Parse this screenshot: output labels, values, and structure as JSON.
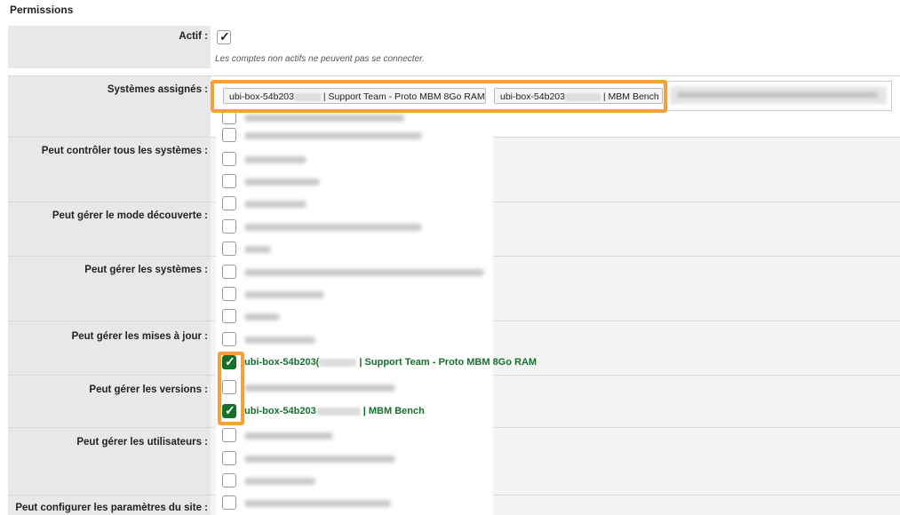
{
  "section": {
    "title": "Permissions"
  },
  "rows": {
    "actif": {
      "label": "Actif :",
      "hint": "Les comptes non actifs ne peuvent pas se connecter."
    },
    "systemes": {
      "label": "Systèmes assignés :"
    },
    "controler": {
      "label": "Peut contrôler tous les systèmes :"
    },
    "decouverte": {
      "label": "Peut gérer le mode découverte :"
    },
    "systemes_gerer": {
      "label": "Peut gérer les systèmes :"
    },
    "mises_a_jour": {
      "label": "Peut gérer les mises à jour :"
    },
    "versions": {
      "label": "Peut gérer les versions :"
    },
    "utilisateurs": {
      "label": "Peut gérer les utilisateurs :"
    },
    "parametres": {
      "label": "Peut configurer les paramètres du site :"
    }
  },
  "tags": [
    {
      "prefix": "ubi-box-54b203",
      "suffix": "| Support Team - Proto MBM 8Go RAM"
    },
    {
      "prefix": "ubi-box-54b203",
      "suffix": "| MBM Bench"
    }
  ],
  "options": {
    "checked1": {
      "prefix": "ubi-box-54b203(",
      "suffix": "| Support Team - Proto MBM 8Go RAM"
    },
    "checked2": {
      "prefix": "ubi-box-54b203",
      "suffix": "| MBM Bench"
    }
  },
  "colors": {
    "accent_green": "#176f2c",
    "highlight_orange": "#f5a03c"
  }
}
